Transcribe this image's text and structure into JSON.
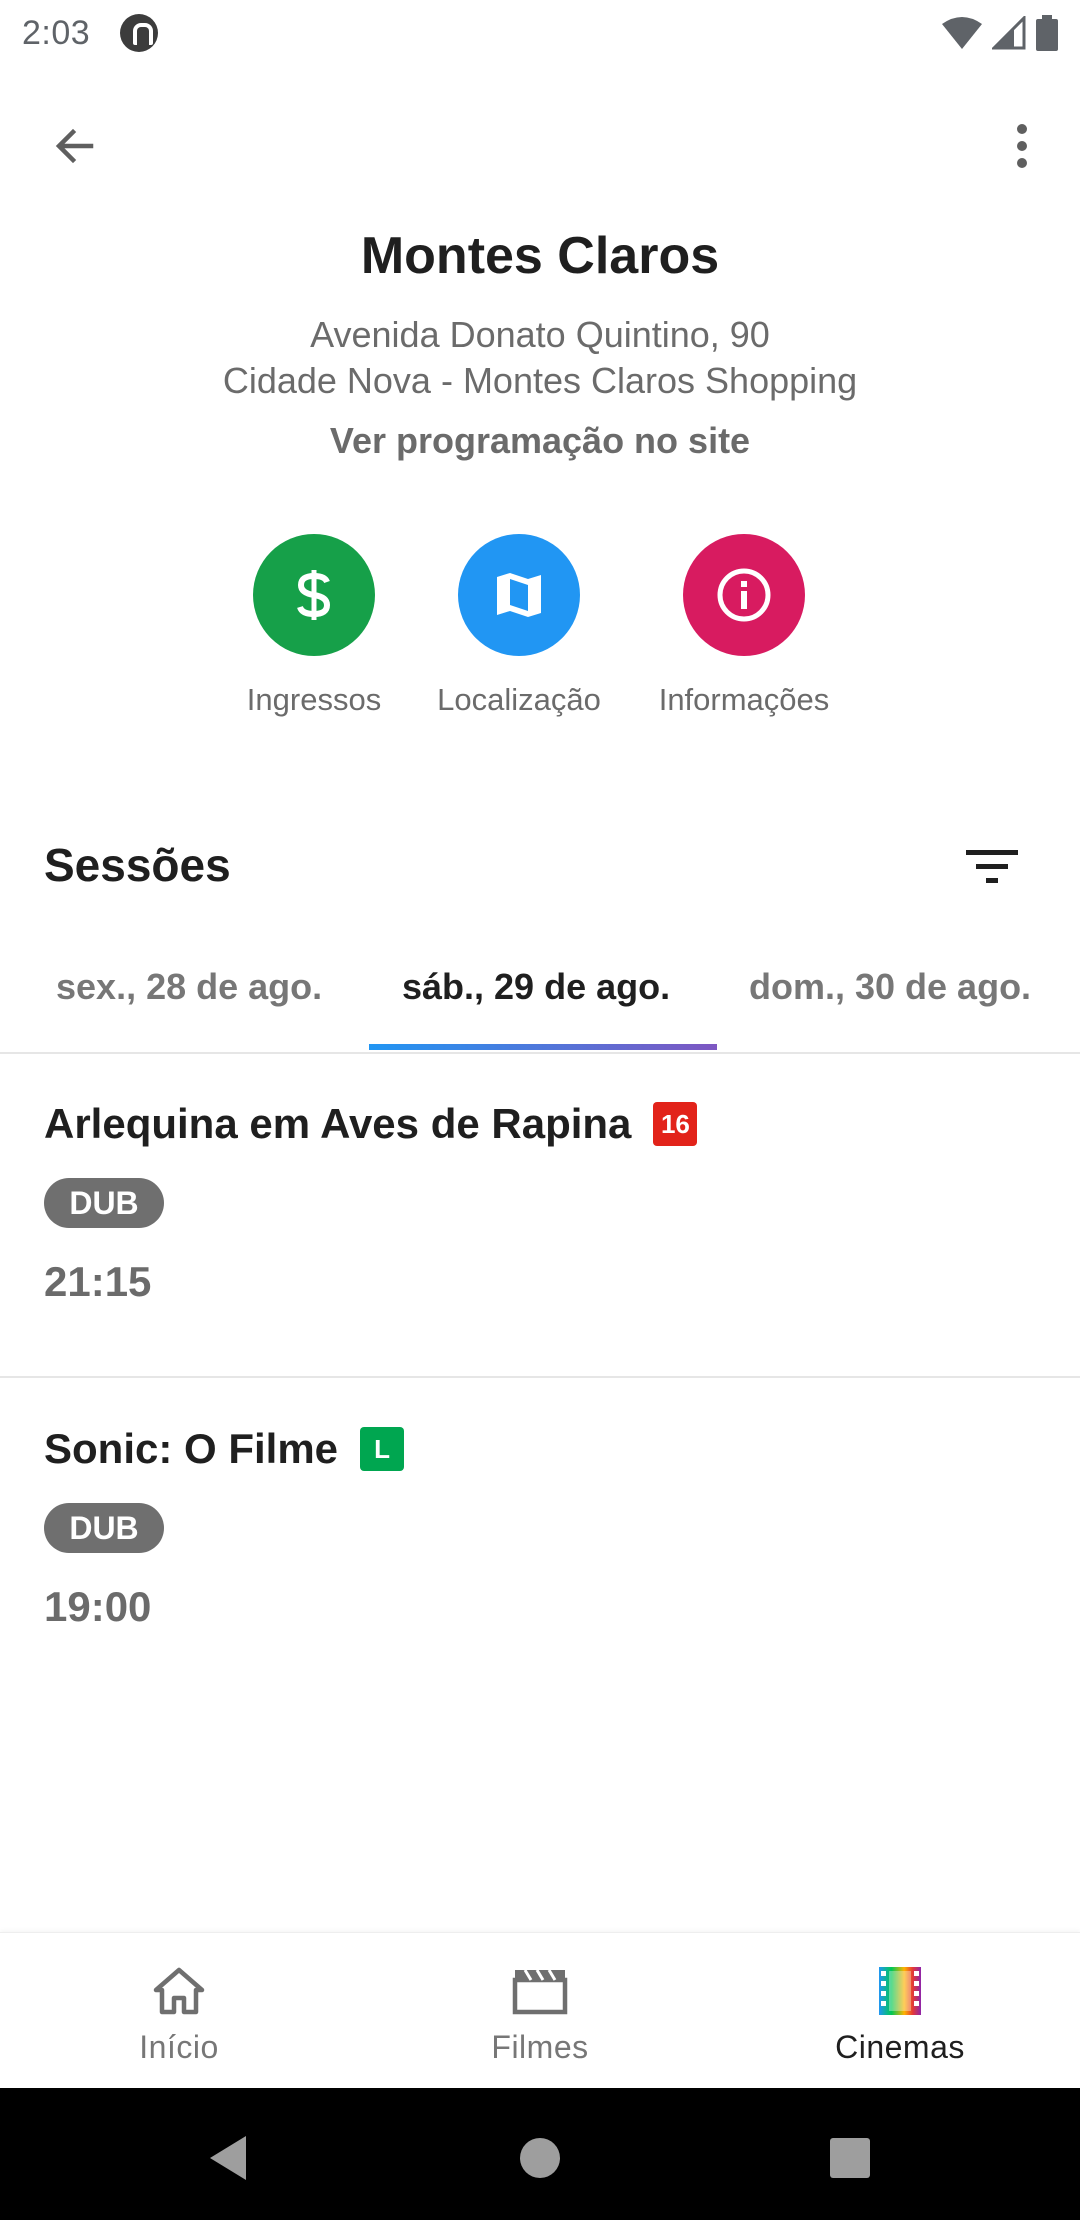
{
  "status_bar": {
    "time": "2:03"
  },
  "header": {
    "title": "Montes Claros",
    "address_line1": "Avenida Donato Quintino, 90",
    "address_line2": "Cidade Nova - Montes Claros Shopping",
    "site_link": "Ver programação no site"
  },
  "actions": [
    {
      "label": "Ingressos",
      "icon": "dollar-icon",
      "color": "#16a049"
    },
    {
      "label": "Localização",
      "icon": "map-icon",
      "color": "#2196f3"
    },
    {
      "label": "Informações",
      "icon": "info-icon",
      "color": "#d81b60"
    }
  ],
  "sessions": {
    "title": "Sessões",
    "tabs": [
      {
        "label": "sex., 28 de ago.",
        "active": false
      },
      {
        "label": "sáb., 29 de ago.",
        "active": true
      },
      {
        "label": "dom., 30 de ago.",
        "active": false
      }
    ],
    "movies": [
      {
        "title": "Arlequina em Aves de Rapina",
        "rating": "16",
        "rating_color": "#e2231a",
        "format": "DUB",
        "time": "21:15"
      },
      {
        "title": "Sonic: O Filme",
        "rating": "L",
        "rating_color": "#00a650",
        "format": "DUB",
        "time": "19:00"
      }
    ]
  },
  "bottom_nav": [
    {
      "label": "Início",
      "icon": "home-icon",
      "active": false
    },
    {
      "label": "Filmes",
      "icon": "clapperboard-icon",
      "active": false
    },
    {
      "label": "Cinemas",
      "icon": "film-strip-icon",
      "active": true
    }
  ]
}
